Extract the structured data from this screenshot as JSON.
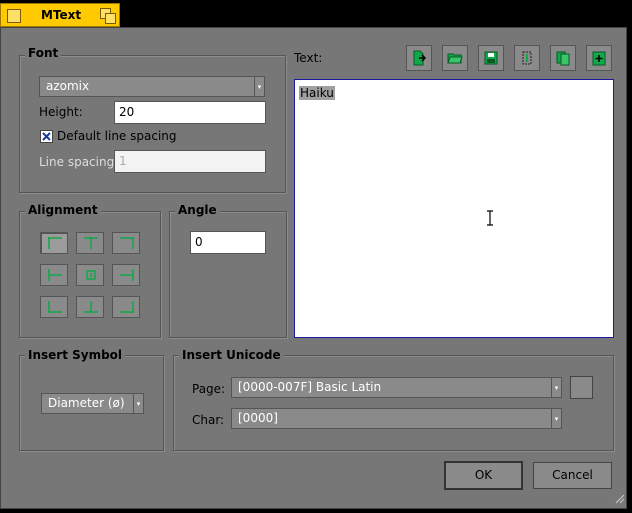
{
  "window": {
    "title": "MText"
  },
  "font": {
    "group_label": "Font",
    "font_name": "azomix",
    "height_label": "Height:",
    "height_value": "20",
    "default_spacing_label": "Default line spacing",
    "default_spacing_checked": true,
    "line_spacing_label": "Line spacing:",
    "line_spacing_value": "1"
  },
  "text": {
    "label": "Text:",
    "content": "Haiku",
    "toolbar": [
      "import-icon",
      "open-folder-icon",
      "save-icon",
      "insert-text-icon",
      "copy-icon",
      "paste-icon"
    ]
  },
  "alignment": {
    "group_label": "Alignment",
    "buttons": [
      "top-left",
      "top-center",
      "top-right",
      "middle-left",
      "middle-center",
      "middle-right",
      "bottom-left",
      "bottom-center",
      "bottom-right"
    ],
    "selected": "top-left"
  },
  "angle": {
    "group_label": "Angle",
    "value": "0"
  },
  "insert_symbol": {
    "group_label": "Insert Symbol",
    "selected": "Diameter (ø)"
  },
  "insert_unicode": {
    "group_label": "Insert Unicode",
    "page_label": "Page:",
    "page_value": "[0000-007F] Basic Latin",
    "char_label": "Char:",
    "char_value": "[0000]"
  },
  "buttons": {
    "ok": "OK",
    "cancel": "Cancel"
  },
  "colors": {
    "tab": "#ffcb00",
    "panel": "#777777",
    "icon_green": "#11a84a",
    "selection": "#a0a0a0",
    "text_border": "#1a1aa0"
  }
}
